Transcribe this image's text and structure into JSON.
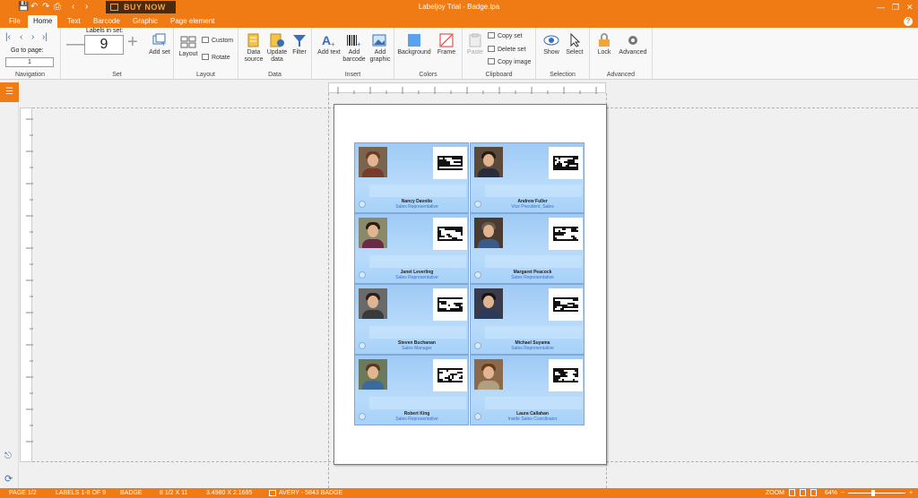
{
  "app": {
    "title": "Labeljoy Trial - Badge.lpa",
    "buy_now": "BUY NOW"
  },
  "tabs": [
    "File",
    "Home",
    "Text",
    "Barcode",
    "Graphic",
    "Page element"
  ],
  "ribbon": {
    "navigation": {
      "goto_label": "Go to page:",
      "goto_value": "1",
      "group": "Navigation"
    },
    "set": {
      "labels_in_set_label": "Labels in set:",
      "labels_in_set_value": "9",
      "add_set": "Add set",
      "group": "Set"
    },
    "layout": {
      "layout": "Layout",
      "custom": "Custom",
      "rotate": "Rotate",
      "group": "Layout"
    },
    "data": {
      "data_source": "Data source",
      "update_data": "Update data",
      "filter": "Filter",
      "group": "Data"
    },
    "insert": {
      "add_text": "Add text",
      "add_barcode": "Add barcode",
      "add_graphic": "Add graphic",
      "group": "Insert"
    },
    "colors": {
      "background": "Background",
      "frame": "Frame",
      "group": "Colors"
    },
    "clipboard": {
      "paste": "Paste",
      "copy_set": "Copy set",
      "delete_set": "Delete set",
      "copy_image": "Copy image",
      "group": "Clipboard"
    },
    "selection": {
      "show": "Show",
      "select": "Select",
      "group": "Selection"
    },
    "advanced": {
      "lock": "Lock",
      "advanced": "Advanced",
      "group": "Advanced"
    }
  },
  "badges": [
    {
      "name": "Nancy Davolio",
      "title": "Sales Representative"
    },
    {
      "name": "Andrew Fuller",
      "title": "Vice President, Sales"
    },
    {
      "name": "Janet Leverling",
      "title": "Sales Representative"
    },
    {
      "name": "Margaret Peacock",
      "title": "Sales Representative"
    },
    {
      "name": "Steven Buchanan",
      "title": "Sales Manager"
    },
    {
      "name": "Michael Suyama",
      "title": "Sales Representative"
    },
    {
      "name": "Robert King",
      "title": "Sales Representative"
    },
    {
      "name": "Laura Callahan",
      "title": "Inside Sales Coordinator"
    }
  ],
  "status": {
    "page": "PAGE 1/2",
    "labels": "LABELS 1-8 OF 9",
    "type": "BADGE",
    "paper": "8 1/2 X 11",
    "size": "3.4980 X 2.1695",
    "template": "AVERY - 5843 BADGE",
    "zoom_label": "ZOOM",
    "zoom_value": "64%"
  }
}
